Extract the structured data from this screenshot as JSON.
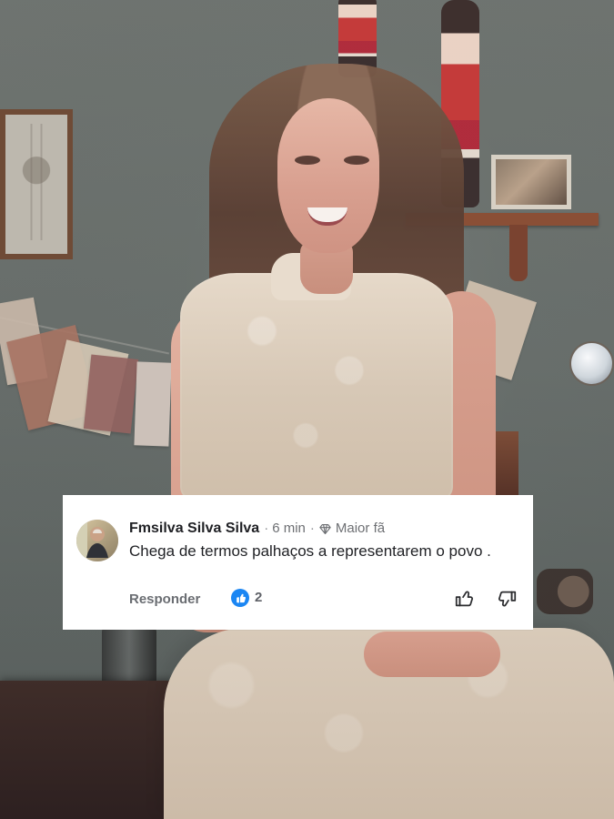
{
  "comment": {
    "author": "Fmsilva Silva Silva",
    "time": "6 min",
    "badge": "Maior fã",
    "text": "Chega de termos palhaços a representarem o povo .",
    "reply_label": "Responder",
    "like_count": "2"
  },
  "icons": {
    "badge": "diamond-icon",
    "reaction": "like-icon",
    "action_up": "thumbs-up-icon",
    "action_down": "thumbs-down-icon"
  },
  "colors": {
    "accent": "#1b86f3",
    "card": "#ffffff",
    "text_primary": "#1f2024",
    "text_secondary": "#6d6f73"
  }
}
